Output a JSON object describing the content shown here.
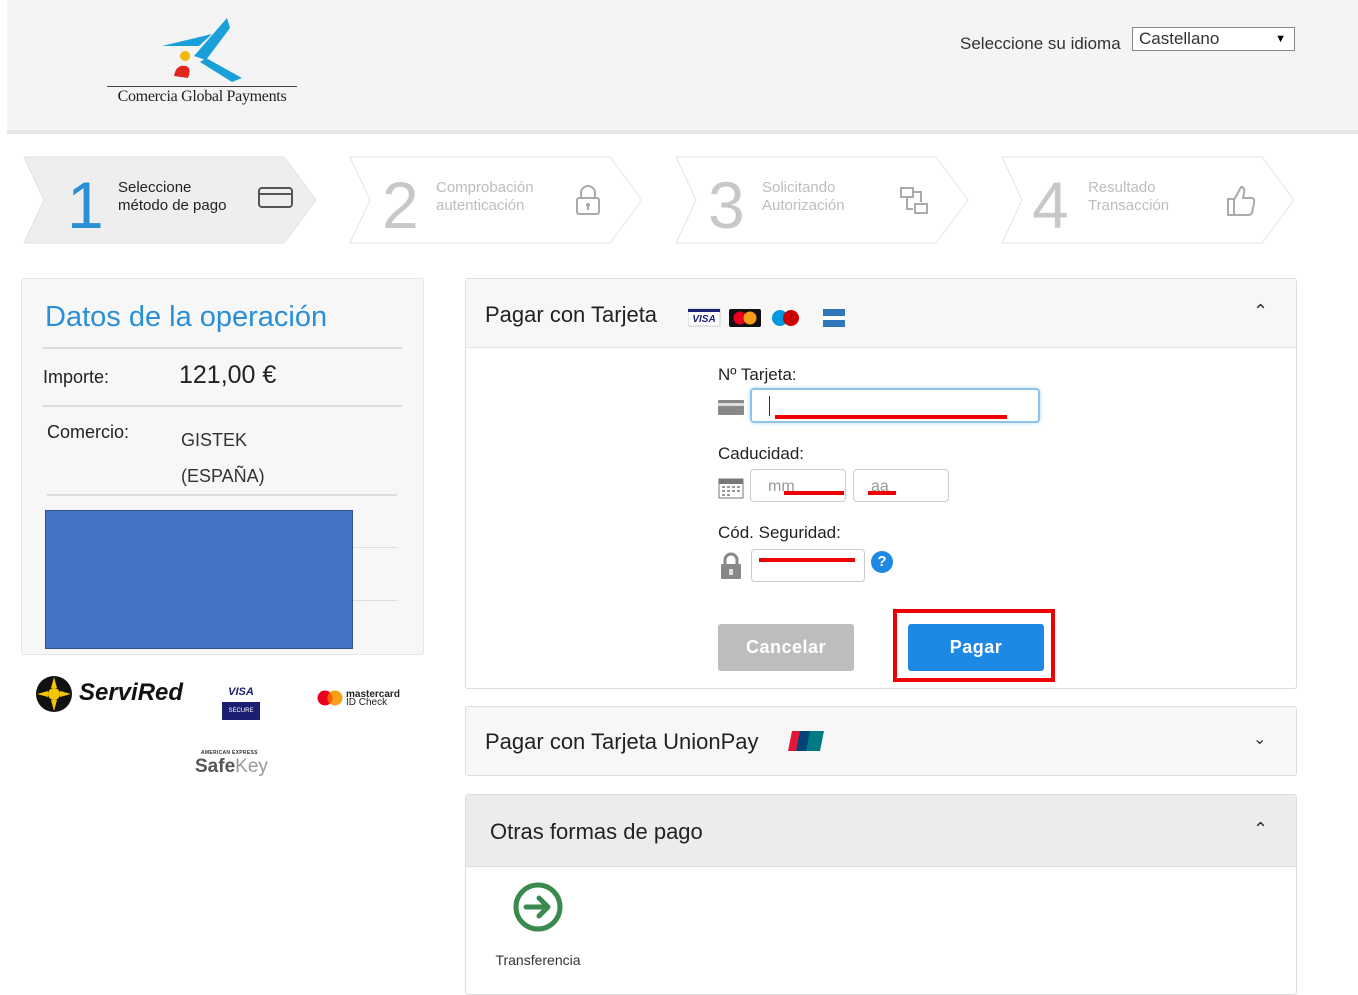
{
  "header": {
    "logo_text": "Comercia Global Payments",
    "language_label": "Seleccione su idioma",
    "language_value": "Castellano"
  },
  "steps": [
    {
      "number": "1",
      "line1": "Seleccione",
      "line2": "método de pago",
      "icon": "credit-card-icon",
      "active": true
    },
    {
      "number": "2",
      "line1": "Comprobación",
      "line2": "autenticación",
      "icon": "lock-icon",
      "active": false
    },
    {
      "number": "3",
      "line1": "Solicitando",
      "line2": "Autorización",
      "icon": "transfer-icon",
      "active": false
    },
    {
      "number": "4",
      "line1": "Resultado",
      "line2": "Transacción",
      "icon": "thumbs-up-icon",
      "active": false
    }
  ],
  "operation": {
    "title": "Datos de la operación",
    "amount_label": "Importe:",
    "amount_value": "121,00 €",
    "merchant_label": "Comercio:",
    "merchant_line1": "GISTEK",
    "merchant_line2": "(ESPAÑA)"
  },
  "brands": {
    "servired": "ServiRed",
    "visa": "VISA",
    "visa_sub": "SECURE",
    "mastercard": "mastercard",
    "mastercard_sub": "ID Check",
    "amex": "AMERICAN EXPRESS",
    "safekey_a": "Safe",
    "safekey_b": "Key"
  },
  "card_form": {
    "title": "Pagar con Tarjeta",
    "card_number_label": "Nº Tarjeta:",
    "expiry_label": "Caducidad:",
    "month_placeholder": "mm",
    "year_placeholder": "aa",
    "cvv_label": "Cód. Seguridad:",
    "cancel_label": "Cancelar",
    "pay_label": "Pagar",
    "card_logos": [
      "VISA",
      "Mastercard",
      "Maestro",
      "American Express"
    ]
  },
  "unionpay": {
    "title": "Pagar con Tarjeta UnionPay"
  },
  "other": {
    "title": "Otras formas de pago",
    "transfer_label": "Transferencia"
  },
  "colors": {
    "accent_blue": "#2a8fd6",
    "pay_button": "#1e88e5",
    "cancel_button": "#bdbdbd",
    "highlight_red": "#e00000",
    "redacted_blue": "#4472c4"
  }
}
